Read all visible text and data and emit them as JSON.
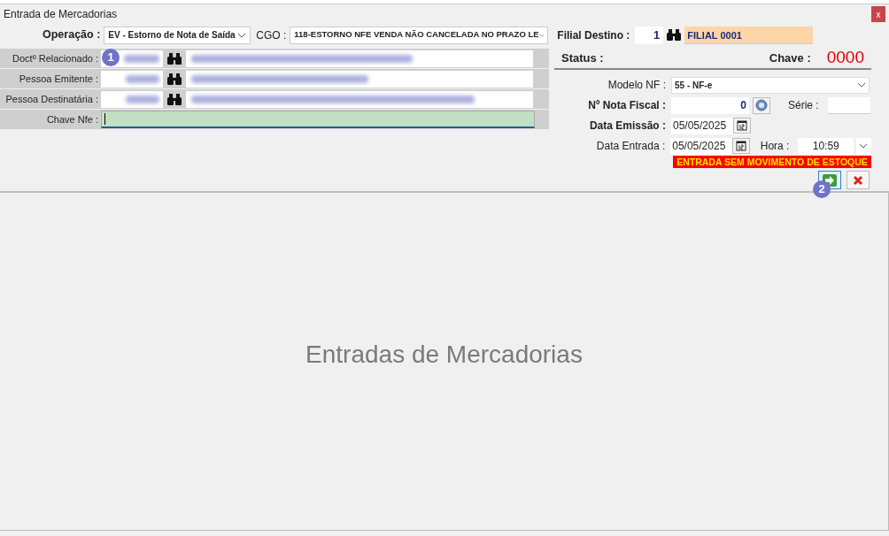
{
  "window": {
    "title": "Entrada de Mercadorias",
    "close": "x"
  },
  "header": {
    "operacao": {
      "label": "Operação :",
      "value": "EV - Estorno de Nota de Saída"
    },
    "cgo": {
      "label": "CGO :",
      "value": "118-ESTORNO NFE VENDA NÃO CANCELADA NO PRAZO LE"
    },
    "filial": {
      "label": "Filial Destino :",
      "code": "1",
      "name": "FILIAL 0001"
    }
  },
  "left_rows": [
    {
      "kind": "lookup",
      "label": "Doctº Relacionado :"
    },
    {
      "kind": "lookup",
      "label": "Pessoa Emitente :"
    },
    {
      "kind": "lookup",
      "label": "Pessoa Destinatária :"
    },
    {
      "kind": "key",
      "label": "Chave Nfe :"
    }
  ],
  "status": {
    "label": "Status :",
    "chave_label": "Chave :",
    "chave_value": "0000"
  },
  "modelo": {
    "label": "Modelo NF :",
    "value": "55 - NF-e"
  },
  "nota": {
    "label": "Nº Nota Fiscal :",
    "value": "0",
    "serie_label": "Série :"
  },
  "emissao": {
    "label": "Data Emissão :",
    "value": "05/05/2025"
  },
  "entrada": {
    "label": "Data Entrada :",
    "value": "05/05/2025",
    "hora_label": "Hora :",
    "hora": "10:59"
  },
  "warning": "ENTRADA SEM MOVIMENTO DE ESTOQUE",
  "markers": [
    "1",
    "2"
  ],
  "body_title": "Entradas de Mercadorias"
}
